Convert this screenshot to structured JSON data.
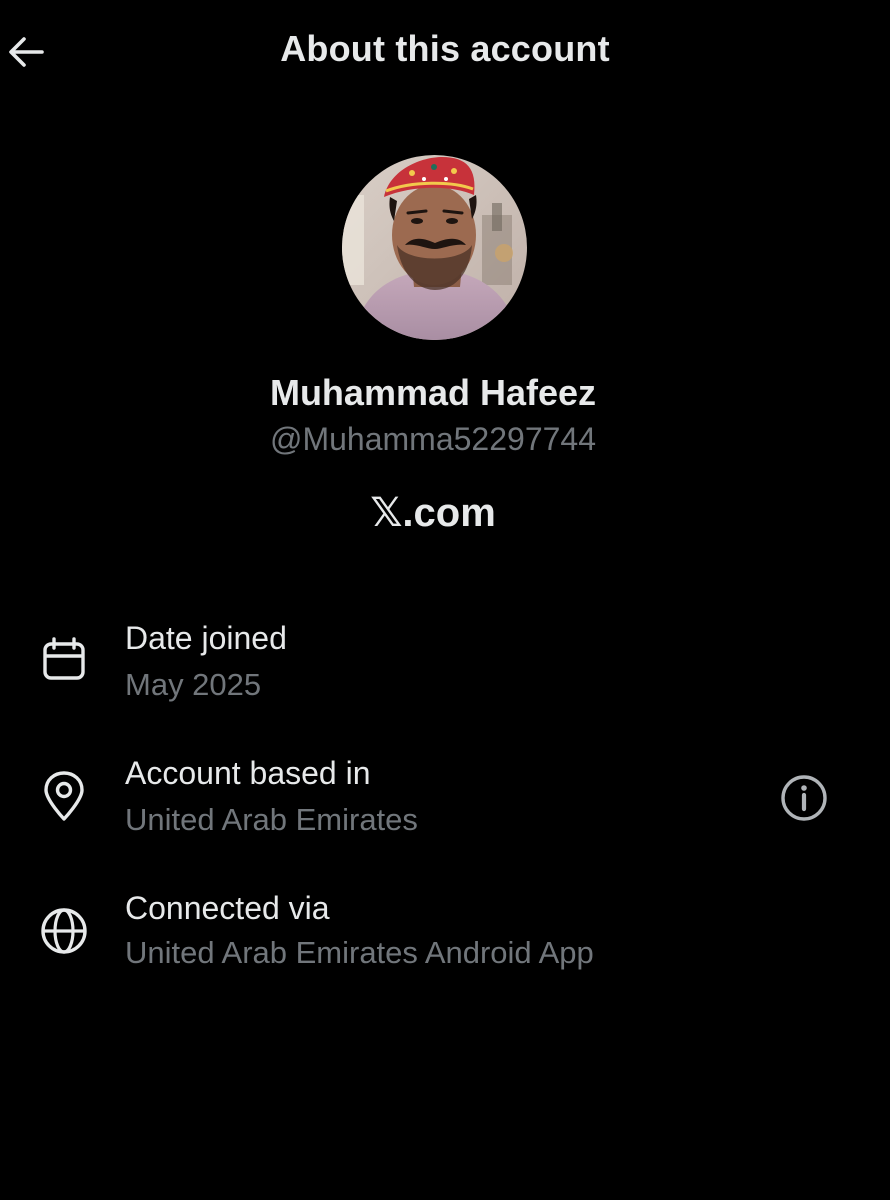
{
  "header": {
    "title": "About this account",
    "back_icon": "arrow-left-icon"
  },
  "profile": {
    "display_name": "Muhammad Hafeez",
    "handle": "@Muhamma52297744",
    "platform": "𝕏.com"
  },
  "details": [
    {
      "icon": "calendar-icon",
      "label": "Date joined",
      "value": "May 2025"
    },
    {
      "icon": "location-pin-icon",
      "label": "Account based in",
      "value": "United Arab Emirates",
      "action_icon": "info-icon"
    },
    {
      "icon": "globe-icon",
      "label": "Connected via",
      "value": "United Arab Emirates Android App"
    }
  ],
  "colors": {
    "background": "#000000",
    "primary_text": "#e7e9ea",
    "secondary_text": "#71767b"
  }
}
